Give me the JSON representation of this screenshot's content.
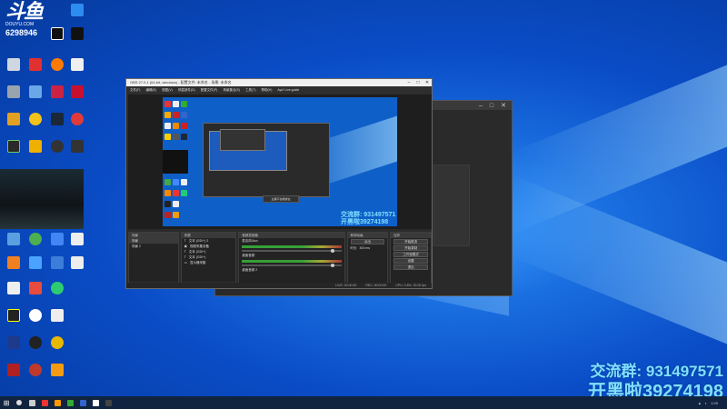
{
  "logo": {
    "mark": "斗鱼",
    "site": "DOUYU.COM",
    "room_id": "6298946"
  },
  "obs": {
    "title": "OBS 27.0.1 (64-bit, windows) - 配置文件: 未命名 - 场景: 未命名",
    "menu": [
      "文件(F)",
      "编辑(E)",
      "视图(V)",
      "停靠部件(D)",
      "配置文件(P)",
      "场景集合(S)",
      "工具(T)",
      "帮助(H)",
      "Ayu! Live.guide"
    ],
    "preview_text_line1": "交流群: 931497571",
    "preview_text_line2": "开黑啦39274198",
    "preview_tooltip": "主播不在哦或在",
    "docks": {
      "scenes": {
        "header": "场景",
        "items": [
          "场景",
          "场景 2"
        ]
      },
      "sources": {
        "header": "来源",
        "items": [
          "文本 (GDI+) 2",
          "视频采集设备",
          "文本 (GDI+)",
          "文本 (GDI+)",
          "显示器采集"
        ]
      },
      "mixer": {
        "header": "音频混音器",
        "channels": [
          "麦克风/Aux",
          "桌面音频",
          "桌面音频 2"
        ]
      },
      "transitions": {
        "header": "转场动画",
        "type": "淡出",
        "duration_label": "时长",
        "duration": "300 ms"
      },
      "controls": {
        "header": "控件",
        "buttons": [
          "开始推流",
          "开始录制",
          "工作室模式",
          "设置",
          "退出"
        ]
      }
    },
    "status": {
      "live": "LIVE: 00:00:00",
      "rec": "REC: 00:00:00",
      "cpu": "CPU: 3.8%, 30.00 fps"
    }
  },
  "overlay": {
    "line1": "交流群: 931497571",
    "line2": "开黑啦39274198"
  },
  "taskbar": {
    "start_label": "⊞",
    "tray_time": "1:09"
  }
}
